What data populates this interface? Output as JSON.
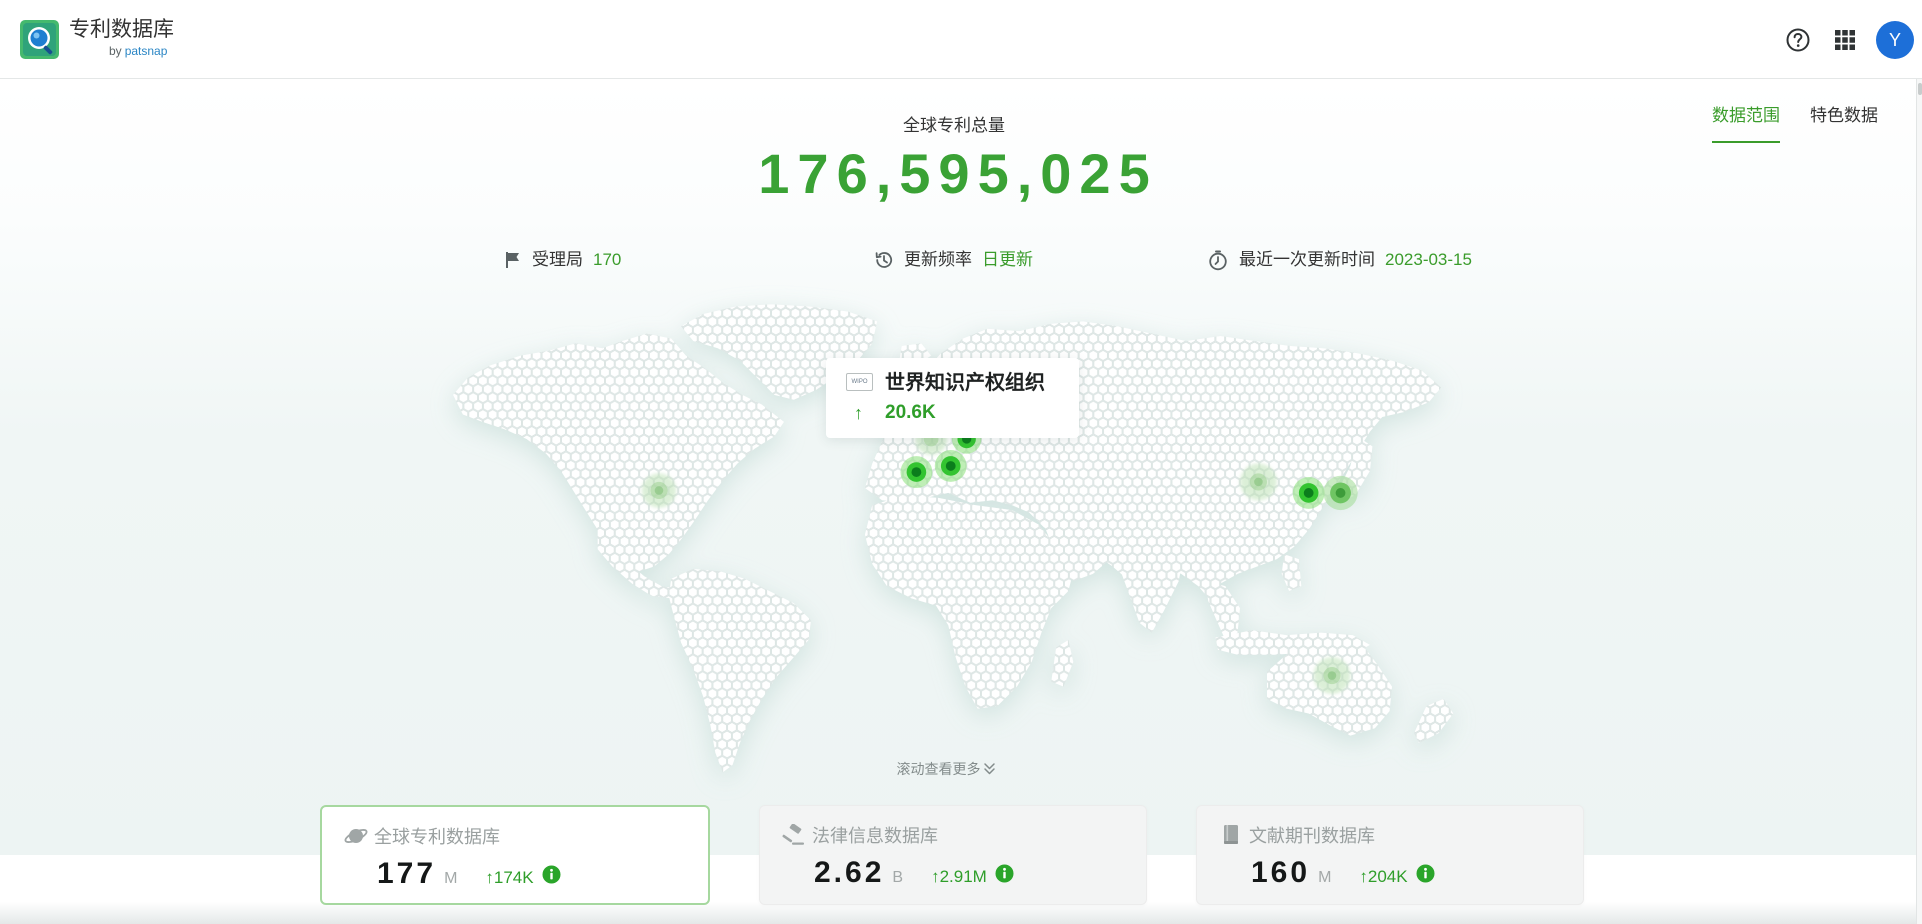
{
  "header": {
    "app_title": "专利数据库",
    "byline_by": "by",
    "byline_brand": "patsnap",
    "avatar_initial": "Y",
    "icons": {
      "logo": "patsnap-search-logo",
      "help": "help-icon",
      "apps": "apps-grid-icon"
    }
  },
  "tabs": [
    {
      "label": "数据范围",
      "active": true
    },
    {
      "label": "特色数据",
      "active": false
    }
  ],
  "summary": {
    "label": "全球专利总量",
    "total": "176,595,025"
  },
  "stats": [
    {
      "icon": "flag-icon",
      "label": "受理局",
      "value": "170"
    },
    {
      "icon": "history-icon",
      "label": "更新频率",
      "value": "日更新"
    },
    {
      "icon": "timer-icon",
      "label": "最近一次更新时间",
      "value": "2023-03-15"
    }
  ],
  "map": {
    "tooltip": {
      "logo_text": "WIPO",
      "title": "世界知识产权组织",
      "arrow": "↑",
      "value": "20.6K"
    }
  },
  "scroll_hint": {
    "label": "滚动查看更多",
    "icon": "chevron-double-down-icon"
  },
  "cards": [
    {
      "icon": "planet-icon",
      "title": "全球专利数据库",
      "value": "177",
      "unit": "M",
      "arrow": "↑",
      "growth": "174K",
      "selected": true
    },
    {
      "icon": "gavel-icon",
      "title": "法律信息数据库",
      "value": "2.62",
      "unit": "B",
      "arrow": "↑",
      "growth": "2.91M",
      "selected": false
    },
    {
      "icon": "book-icon",
      "title": "文献期刊数据库",
      "value": "160",
      "unit": "M",
      "arrow": "↑",
      "growth": "204K",
      "selected": false
    }
  ],
  "colors": {
    "accent": "#3a9c2b",
    "total": "#3aa235",
    "avatar": "#1d6fd8",
    "card_border_selected": "#a6d89f",
    "map_marker": "#33c430"
  }
}
